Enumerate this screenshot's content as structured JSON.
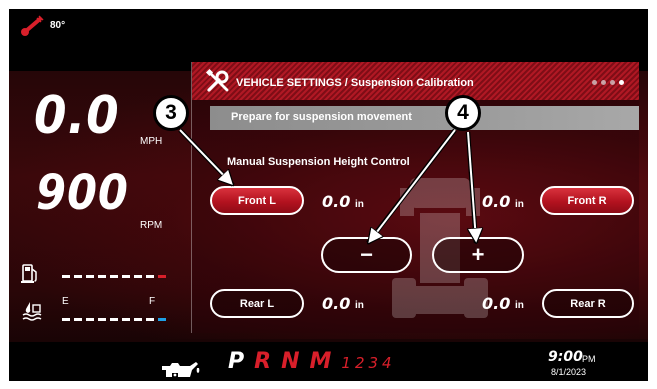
{
  "status": {
    "temperature": "80°"
  },
  "gauges": {
    "speed": "0.0",
    "speed_unit": "MPH",
    "rpm": "900",
    "rpm_unit": "RPM",
    "fuel_empty_label": "E",
    "fuel_full_label": "F"
  },
  "panel": {
    "title": "VEHICLE SETTINGS / Suspension Calibration",
    "page_count": 4,
    "active_page": 4,
    "prompt": "Prepare for suspension movement",
    "section_label": "Manual Suspension Height Control"
  },
  "controls": {
    "front_l": "Front L",
    "front_r": "Front R",
    "rear_l": "Rear L",
    "rear_r": "Rear R",
    "minus": "−",
    "plus": "+"
  },
  "heights": {
    "front_l": "0.0",
    "front_r": "0.0",
    "rear_l": "0.0",
    "rear_r": "0.0",
    "unit": "in"
  },
  "callouts": {
    "c3": "3",
    "c4": "4"
  },
  "gear_selector": {
    "gears": [
      "P",
      "R",
      "N",
      "M"
    ],
    "manual_gears": "1234",
    "active": "P"
  },
  "clock": {
    "time": "9:00",
    "ampm": "PM",
    "date": "8/1/2023"
  },
  "colors": {
    "accent_red": "#d81f2a",
    "header_red": "#b01824",
    "coolant_blue": "#1ea0e6"
  }
}
